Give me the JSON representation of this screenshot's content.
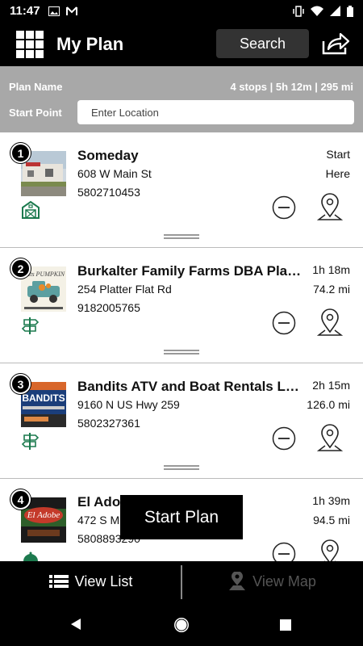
{
  "status": {
    "time": "11:47"
  },
  "header": {
    "title": "My Plan",
    "search_label": "Search"
  },
  "plan": {
    "name_label": "Plan Name",
    "stats": "4 stops | 5h 12m | 295 mi",
    "start_label": "Start Point",
    "start_placeholder": "Enter Location"
  },
  "stops": [
    {
      "number": "1",
      "name": "Someday",
      "address": "608 W Main St",
      "phone": "5802710453",
      "line1": "Start",
      "line2": "Here",
      "category_icon": "barn-icon"
    },
    {
      "number": "2",
      "name": "Burkalter Family Farms DBA Platter Flats Pumpkin Patch",
      "address": "254 Platter Flat Rd",
      "phone": "9182005765",
      "line1": "1h 18m",
      "line2": "74.2 mi",
      "category_icon": "signpost-icon"
    },
    {
      "number": "3",
      "name": "Bandits ATV and Boat Rentals LLC",
      "address": "9160 N US Hwy 259",
      "phone": "5802327361",
      "line1": "2h 15m",
      "line2": "126.0 mi",
      "category_icon": "signpost-icon"
    },
    {
      "number": "4",
      "name": "El Adobe",
      "address": "472 S M",
      "phone": "5808893290",
      "line1": "1h 39m",
      "line2": "94.5 mi",
      "category_icon": "dining-icon"
    }
  ],
  "thumb_text": {
    "stop2": "Platter Flats PUMPKIN PATCH",
    "stop3": "BANDITS",
    "stop4": "El Adobe"
  },
  "start_plan_label": "Start Plan",
  "tabs": {
    "list": "View List",
    "map": "View Map"
  },
  "colors": {
    "accent_green": "#1c7a4e",
    "header_bg": "#000000",
    "plan_bg": "#a8a8a8"
  }
}
